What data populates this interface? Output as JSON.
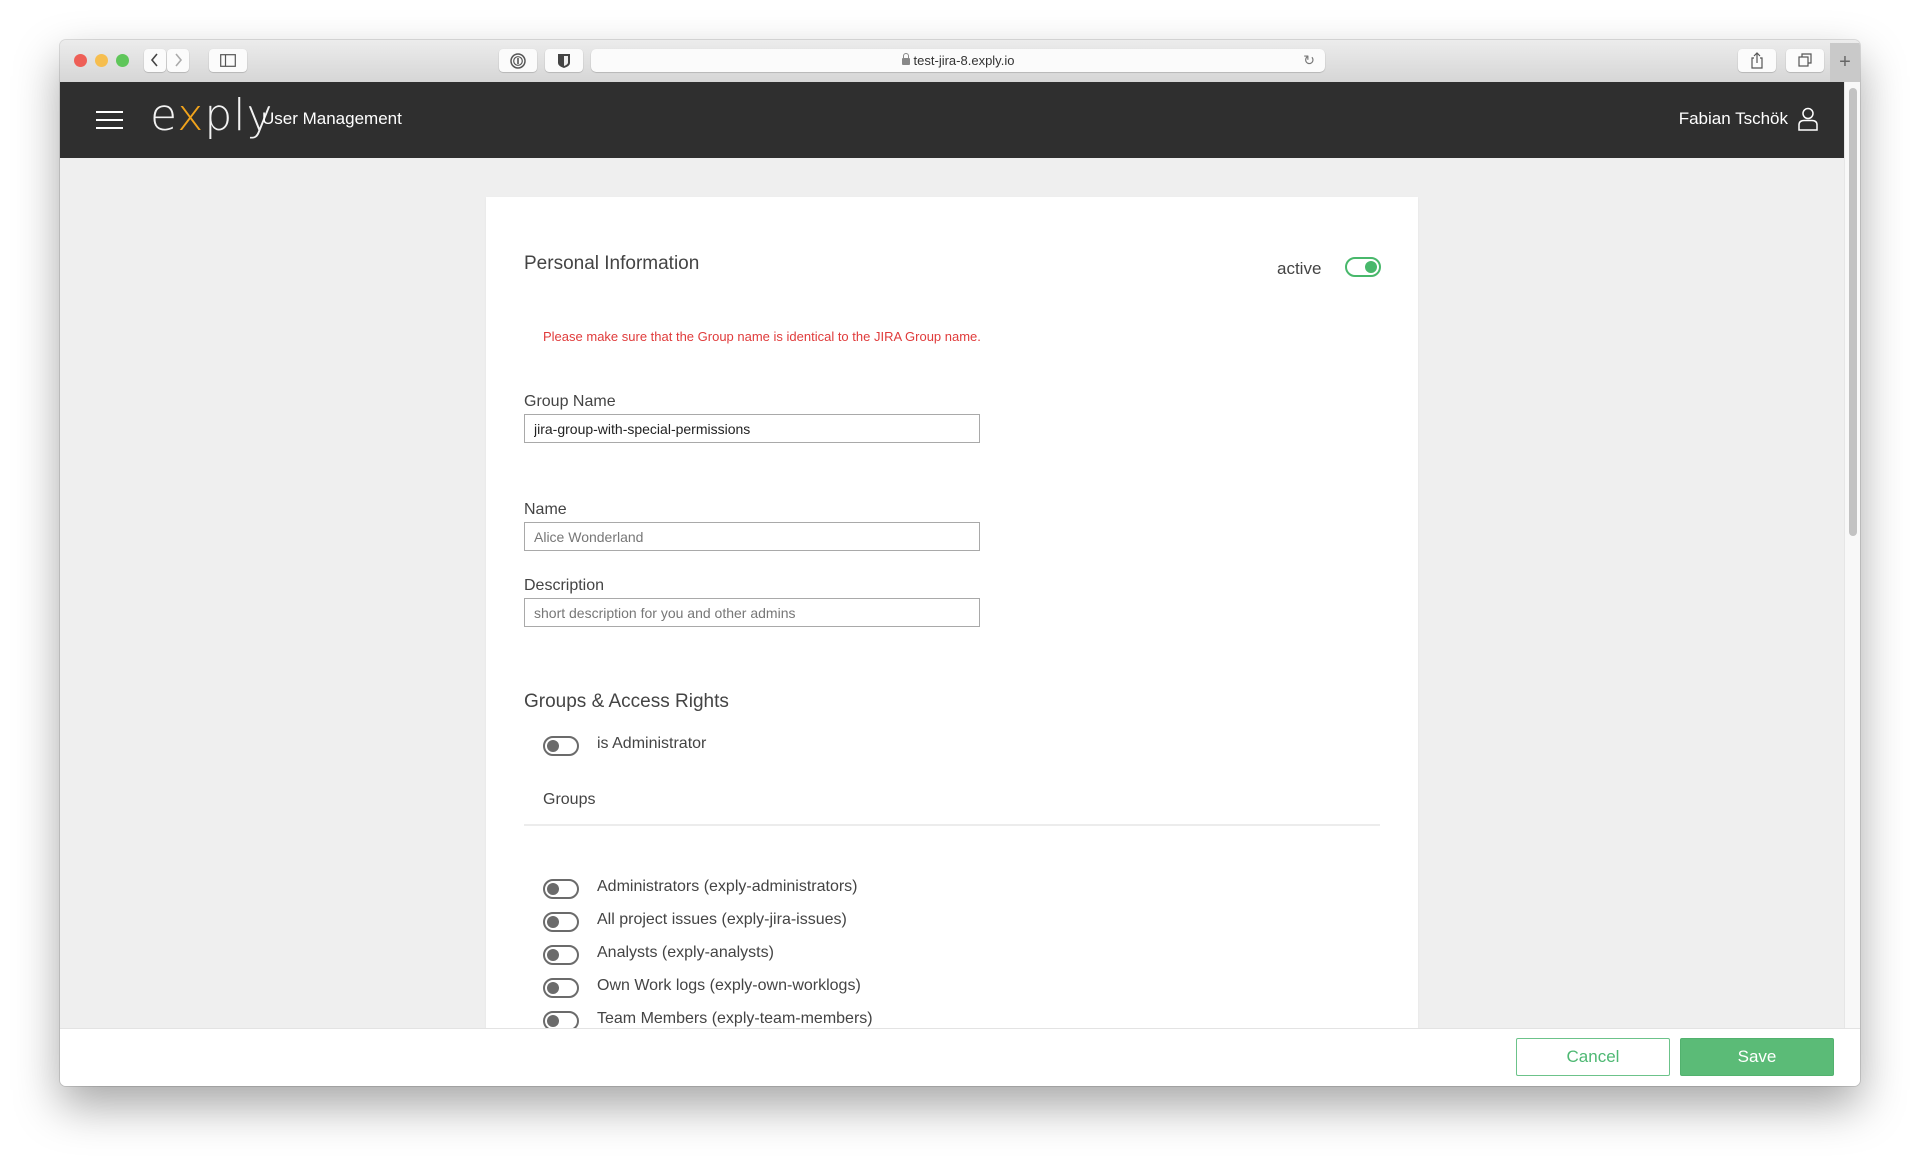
{
  "browser": {
    "url": "test-jira-8.exply.io",
    "back_icon": "chevron-left-icon",
    "forward_icon": "chevron-right-icon",
    "sidebar_icon": "sidebar-icon",
    "password_icon": "1password-icon",
    "shield_icon": "shield-icon",
    "reload_icon": "reload-icon",
    "share_icon": "share-icon",
    "tabs_icon": "tabs-icon",
    "new_tab_label": "+"
  },
  "header": {
    "logo_prefix": "e",
    "logo_x": "x",
    "logo_suffix": "ply",
    "title": "User Management",
    "user_name": "Fabian Tschök"
  },
  "form": {
    "section_title": "Personal Information",
    "active_label": "active",
    "active": true,
    "warning": "Please make sure that the Group name is identical to the JIRA Group name.",
    "group_name": {
      "label": "Group Name",
      "value": "jira-group-with-special-permissions",
      "placeholder": ""
    },
    "name": {
      "label": "Name",
      "value": "",
      "placeholder": "Alice Wonderland"
    },
    "description": {
      "label": "Description",
      "value": "",
      "placeholder": "short description for you and other admins"
    }
  },
  "access": {
    "section_title": "Groups & Access Rights",
    "is_admin_label": "is Administrator",
    "is_admin": false,
    "groups_label": "Groups",
    "groups": [
      {
        "label": "Administrators (exply-administrators)",
        "enabled": false
      },
      {
        "label": "All project issues (exply-jira-issues)",
        "enabled": false
      },
      {
        "label": "Analysts (exply-analysts)",
        "enabled": false
      },
      {
        "label": "Own Work logs (exply-own-worklogs)",
        "enabled": false
      },
      {
        "label": "Team Members (exply-team-members)",
        "enabled": false
      }
    ]
  },
  "footer": {
    "cancel_label": "Cancel",
    "save_label": "Save"
  }
}
